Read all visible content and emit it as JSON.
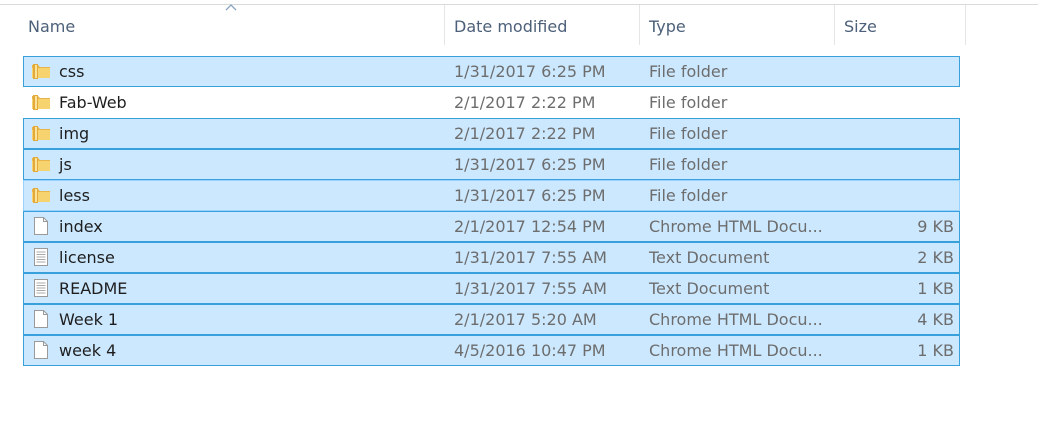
{
  "columns": {
    "name": "Name",
    "date": "Date modified",
    "type": "Type",
    "size": "Size"
  },
  "colors": {
    "selection_bg": "#cce8ff",
    "selection_border": "#38a0da",
    "folder": "#e8b54a"
  },
  "files": [
    {
      "name": "css",
      "date": "1/31/2017 6:25 PM",
      "type": "File folder",
      "size": "",
      "icon": "folder-icon",
      "state": "selected"
    },
    {
      "name": "Fab-Web",
      "date": "2/1/2017 2:22 PM",
      "type": "File folder",
      "size": "",
      "icon": "folder-icon",
      "state": "none"
    },
    {
      "name": "img",
      "date": "2/1/2017 2:22 PM",
      "type": "File folder",
      "size": "",
      "icon": "folder-icon",
      "state": "selected"
    },
    {
      "name": "js",
      "date": "1/31/2017 6:25 PM",
      "type": "File folder",
      "size": "",
      "icon": "folder-icon",
      "state": "selected"
    },
    {
      "name": "less",
      "date": "1/31/2017 6:25 PM",
      "type": "File folder",
      "size": "",
      "icon": "folder-icon",
      "state": "focused"
    },
    {
      "name": "index",
      "date": "2/1/2017 12:54 PM",
      "type": "Chrome HTML Docu...",
      "size": "9 KB",
      "icon": "blank-file-icon",
      "state": "selected"
    },
    {
      "name": "license",
      "date": "1/31/2017 7:55 AM",
      "type": "Text Document",
      "size": "2 KB",
      "icon": "text-file-icon",
      "state": "selected"
    },
    {
      "name": "README",
      "date": "1/31/2017 7:55 AM",
      "type": "Text Document",
      "size": "1 KB",
      "icon": "text-file-icon",
      "state": "selected"
    },
    {
      "name": "Week 1",
      "date": "2/1/2017 5:20 AM",
      "type": "Chrome HTML Docu...",
      "size": "4 KB",
      "icon": "blank-file-icon",
      "state": "selected"
    },
    {
      "name": "week 4",
      "date": "4/5/2016 10:47 PM",
      "type": "Chrome HTML Docu...",
      "size": "1 KB",
      "icon": "blank-file-icon",
      "state": "selected"
    }
  ]
}
